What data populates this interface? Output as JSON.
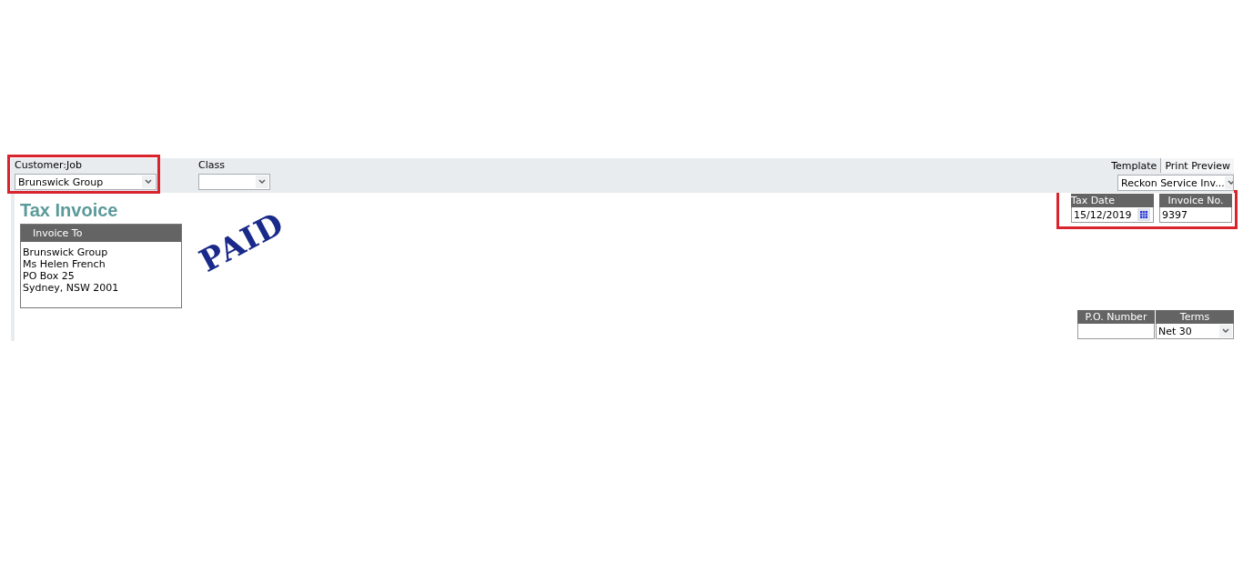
{
  "header": {
    "customer_job": {
      "label": "Customer:Job",
      "value": "Brunswick Group",
      "highlighted": true
    },
    "class": {
      "label": "Class"
    },
    "tabs": [
      {
        "label": "Template",
        "selected": true
      },
      {
        "label": "Print Preview",
        "selected": false
      }
    ],
    "template": {
      "value": "Reckon Service Inv..."
    }
  },
  "form": {
    "title": "Tax Invoice",
    "invoice_to": {
      "label": "Invoice To",
      "lines": [
        "Brunswick Group",
        "Ms Helen French",
        "PO Box 25",
        "Sydney, NSW 2001"
      ]
    },
    "stamp": "PAID",
    "date_number": {
      "highlighted": true,
      "tax_date": {
        "label": "Tax Date",
        "value": "15/12/2019"
      },
      "invoice_no": {
        "label": "Invoice No.",
        "value": "9397"
      }
    },
    "po_number": {
      "label": "P.O. Number"
    },
    "terms": {
      "label": "Terms",
      "value": "Net 30"
    }
  }
}
